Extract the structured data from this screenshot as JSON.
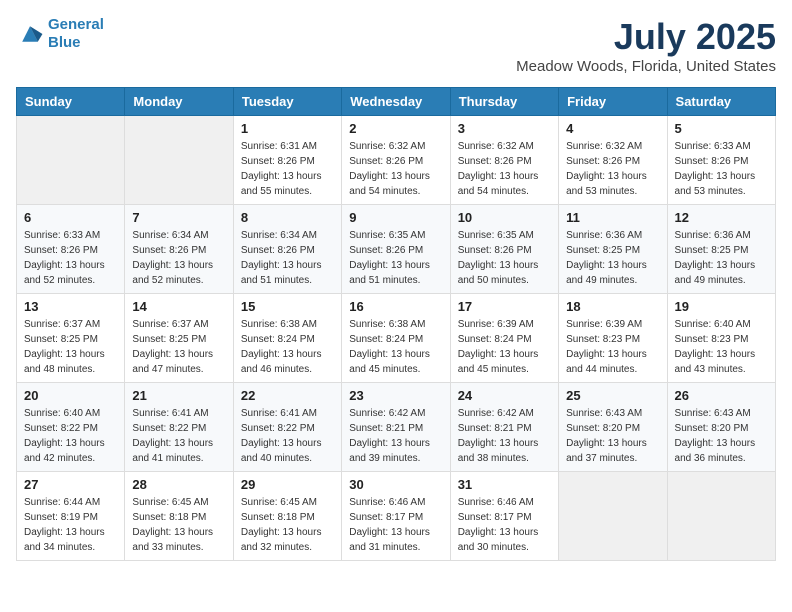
{
  "logo": {
    "line1": "General",
    "line2": "Blue"
  },
  "title": "July 2025",
  "subtitle": "Meadow Woods, Florida, United States",
  "weekdays": [
    "Sunday",
    "Monday",
    "Tuesday",
    "Wednesday",
    "Thursday",
    "Friday",
    "Saturday"
  ],
  "weeks": [
    [
      {
        "day": "",
        "sunrise": "",
        "sunset": "",
        "daylight": ""
      },
      {
        "day": "",
        "sunrise": "",
        "sunset": "",
        "daylight": ""
      },
      {
        "day": "1",
        "sunrise": "Sunrise: 6:31 AM",
        "sunset": "Sunset: 8:26 PM",
        "daylight": "Daylight: 13 hours and 55 minutes."
      },
      {
        "day": "2",
        "sunrise": "Sunrise: 6:32 AM",
        "sunset": "Sunset: 8:26 PM",
        "daylight": "Daylight: 13 hours and 54 minutes."
      },
      {
        "day": "3",
        "sunrise": "Sunrise: 6:32 AM",
        "sunset": "Sunset: 8:26 PM",
        "daylight": "Daylight: 13 hours and 54 minutes."
      },
      {
        "day": "4",
        "sunrise": "Sunrise: 6:32 AM",
        "sunset": "Sunset: 8:26 PM",
        "daylight": "Daylight: 13 hours and 53 minutes."
      },
      {
        "day": "5",
        "sunrise": "Sunrise: 6:33 AM",
        "sunset": "Sunset: 8:26 PM",
        "daylight": "Daylight: 13 hours and 53 minutes."
      }
    ],
    [
      {
        "day": "6",
        "sunrise": "Sunrise: 6:33 AM",
        "sunset": "Sunset: 8:26 PM",
        "daylight": "Daylight: 13 hours and 52 minutes."
      },
      {
        "day": "7",
        "sunrise": "Sunrise: 6:34 AM",
        "sunset": "Sunset: 8:26 PM",
        "daylight": "Daylight: 13 hours and 52 minutes."
      },
      {
        "day": "8",
        "sunrise": "Sunrise: 6:34 AM",
        "sunset": "Sunset: 8:26 PM",
        "daylight": "Daylight: 13 hours and 51 minutes."
      },
      {
        "day": "9",
        "sunrise": "Sunrise: 6:35 AM",
        "sunset": "Sunset: 8:26 PM",
        "daylight": "Daylight: 13 hours and 51 minutes."
      },
      {
        "day": "10",
        "sunrise": "Sunrise: 6:35 AM",
        "sunset": "Sunset: 8:26 PM",
        "daylight": "Daylight: 13 hours and 50 minutes."
      },
      {
        "day": "11",
        "sunrise": "Sunrise: 6:36 AM",
        "sunset": "Sunset: 8:25 PM",
        "daylight": "Daylight: 13 hours and 49 minutes."
      },
      {
        "day": "12",
        "sunrise": "Sunrise: 6:36 AM",
        "sunset": "Sunset: 8:25 PM",
        "daylight": "Daylight: 13 hours and 49 minutes."
      }
    ],
    [
      {
        "day": "13",
        "sunrise": "Sunrise: 6:37 AM",
        "sunset": "Sunset: 8:25 PM",
        "daylight": "Daylight: 13 hours and 48 minutes."
      },
      {
        "day": "14",
        "sunrise": "Sunrise: 6:37 AM",
        "sunset": "Sunset: 8:25 PM",
        "daylight": "Daylight: 13 hours and 47 minutes."
      },
      {
        "day": "15",
        "sunrise": "Sunrise: 6:38 AM",
        "sunset": "Sunset: 8:24 PM",
        "daylight": "Daylight: 13 hours and 46 minutes."
      },
      {
        "day": "16",
        "sunrise": "Sunrise: 6:38 AM",
        "sunset": "Sunset: 8:24 PM",
        "daylight": "Daylight: 13 hours and 45 minutes."
      },
      {
        "day": "17",
        "sunrise": "Sunrise: 6:39 AM",
        "sunset": "Sunset: 8:24 PM",
        "daylight": "Daylight: 13 hours and 45 minutes."
      },
      {
        "day": "18",
        "sunrise": "Sunrise: 6:39 AM",
        "sunset": "Sunset: 8:23 PM",
        "daylight": "Daylight: 13 hours and 44 minutes."
      },
      {
        "day": "19",
        "sunrise": "Sunrise: 6:40 AM",
        "sunset": "Sunset: 8:23 PM",
        "daylight": "Daylight: 13 hours and 43 minutes."
      }
    ],
    [
      {
        "day": "20",
        "sunrise": "Sunrise: 6:40 AM",
        "sunset": "Sunset: 8:22 PM",
        "daylight": "Daylight: 13 hours and 42 minutes."
      },
      {
        "day": "21",
        "sunrise": "Sunrise: 6:41 AM",
        "sunset": "Sunset: 8:22 PM",
        "daylight": "Daylight: 13 hours and 41 minutes."
      },
      {
        "day": "22",
        "sunrise": "Sunrise: 6:41 AM",
        "sunset": "Sunset: 8:22 PM",
        "daylight": "Daylight: 13 hours and 40 minutes."
      },
      {
        "day": "23",
        "sunrise": "Sunrise: 6:42 AM",
        "sunset": "Sunset: 8:21 PM",
        "daylight": "Daylight: 13 hours and 39 minutes."
      },
      {
        "day": "24",
        "sunrise": "Sunrise: 6:42 AM",
        "sunset": "Sunset: 8:21 PM",
        "daylight": "Daylight: 13 hours and 38 minutes."
      },
      {
        "day": "25",
        "sunrise": "Sunrise: 6:43 AM",
        "sunset": "Sunset: 8:20 PM",
        "daylight": "Daylight: 13 hours and 37 minutes."
      },
      {
        "day": "26",
        "sunrise": "Sunrise: 6:43 AM",
        "sunset": "Sunset: 8:20 PM",
        "daylight": "Daylight: 13 hours and 36 minutes."
      }
    ],
    [
      {
        "day": "27",
        "sunrise": "Sunrise: 6:44 AM",
        "sunset": "Sunset: 8:19 PM",
        "daylight": "Daylight: 13 hours and 34 minutes."
      },
      {
        "day": "28",
        "sunrise": "Sunrise: 6:45 AM",
        "sunset": "Sunset: 8:18 PM",
        "daylight": "Daylight: 13 hours and 33 minutes."
      },
      {
        "day": "29",
        "sunrise": "Sunrise: 6:45 AM",
        "sunset": "Sunset: 8:18 PM",
        "daylight": "Daylight: 13 hours and 32 minutes."
      },
      {
        "day": "30",
        "sunrise": "Sunrise: 6:46 AM",
        "sunset": "Sunset: 8:17 PM",
        "daylight": "Daylight: 13 hours and 31 minutes."
      },
      {
        "day": "31",
        "sunrise": "Sunrise: 6:46 AM",
        "sunset": "Sunset: 8:17 PM",
        "daylight": "Daylight: 13 hours and 30 minutes."
      },
      {
        "day": "",
        "sunrise": "",
        "sunset": "",
        "daylight": ""
      },
      {
        "day": "",
        "sunrise": "",
        "sunset": "",
        "daylight": ""
      }
    ]
  ]
}
